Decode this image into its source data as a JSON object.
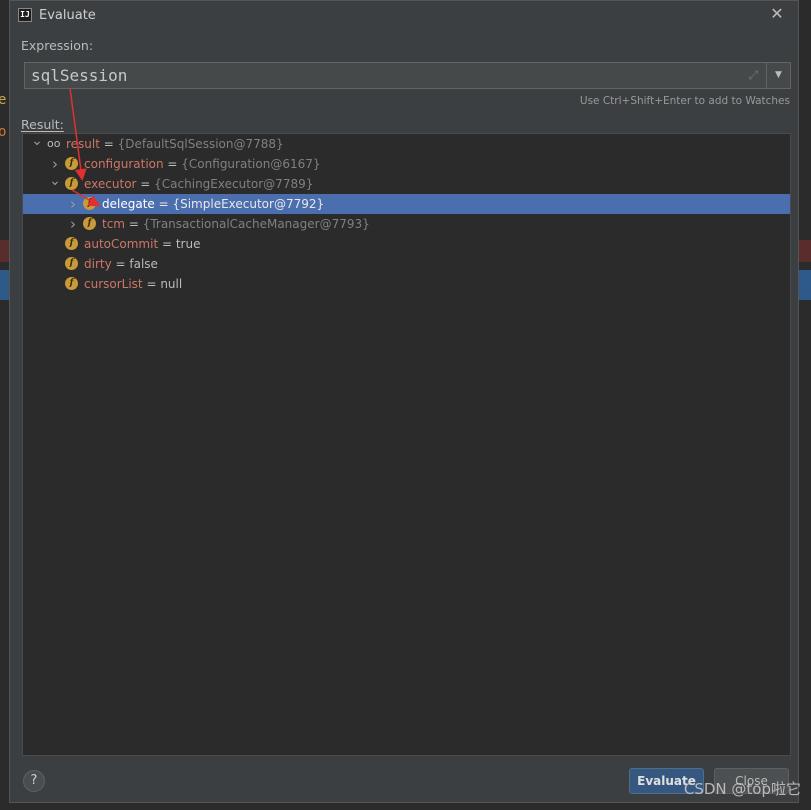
{
  "window": {
    "title": "Evaluate",
    "app_icon_text": "IJ"
  },
  "expression": {
    "label": "Expression:",
    "value": "sqlSession",
    "hint": "Use Ctrl+Shift+Enter to add to Watches"
  },
  "result": {
    "label_first": "R",
    "label_rest": "esult:",
    "rows": [
      {
        "name": "result",
        "eq": " = ",
        "value": "{DefaultSqlSession@7788}",
        "kind": "ref",
        "icon": "glasses-icon",
        "chevron": "down"
      },
      {
        "name": "configuration",
        "eq": " = ",
        "value": "{Configuration@6167}",
        "kind": "ref",
        "icon": "field-icon",
        "chevron": "right"
      },
      {
        "name": "executor",
        "eq": " = ",
        "value": "{CachingExecutor@7789}",
        "kind": "ref",
        "icon": "field-icon",
        "chevron": "down"
      },
      {
        "name": "delegate",
        "eq": " = ",
        "value": "{SimpleExecutor@7792}",
        "kind": "ref",
        "icon": "field-icon",
        "chevron": "right",
        "selected": true
      },
      {
        "name": "tcm",
        "eq": " = ",
        "value": "{TransactionalCacheManager@7793}",
        "kind": "ref",
        "icon": "field-icon",
        "chevron": "right"
      },
      {
        "name": "autoCommit",
        "eq": " = ",
        "value": "true",
        "kind": "val",
        "icon": "field-icon",
        "chevron": "none"
      },
      {
        "name": "dirty",
        "eq": " = ",
        "value": "false",
        "kind": "val",
        "icon": "field-icon",
        "chevron": "none"
      },
      {
        "name": "cursorList",
        "eq": " = ",
        "value": "null",
        "kind": "val",
        "icon": "field-icon",
        "chevron": "none"
      }
    ]
  },
  "buttons": {
    "help": "?",
    "evaluate": "Evaluate",
    "close": "Close"
  },
  "icons": {
    "field_letter": "f",
    "close": "✕",
    "dropdown": "▼",
    "expand": "⤢"
  },
  "watermark": "CSDN @top啦它",
  "colors": {
    "selection": "#4b6eaf",
    "field_name": "#cc7766",
    "annotation_arrow": "#e03030",
    "field_icon": "#c79a3a"
  }
}
